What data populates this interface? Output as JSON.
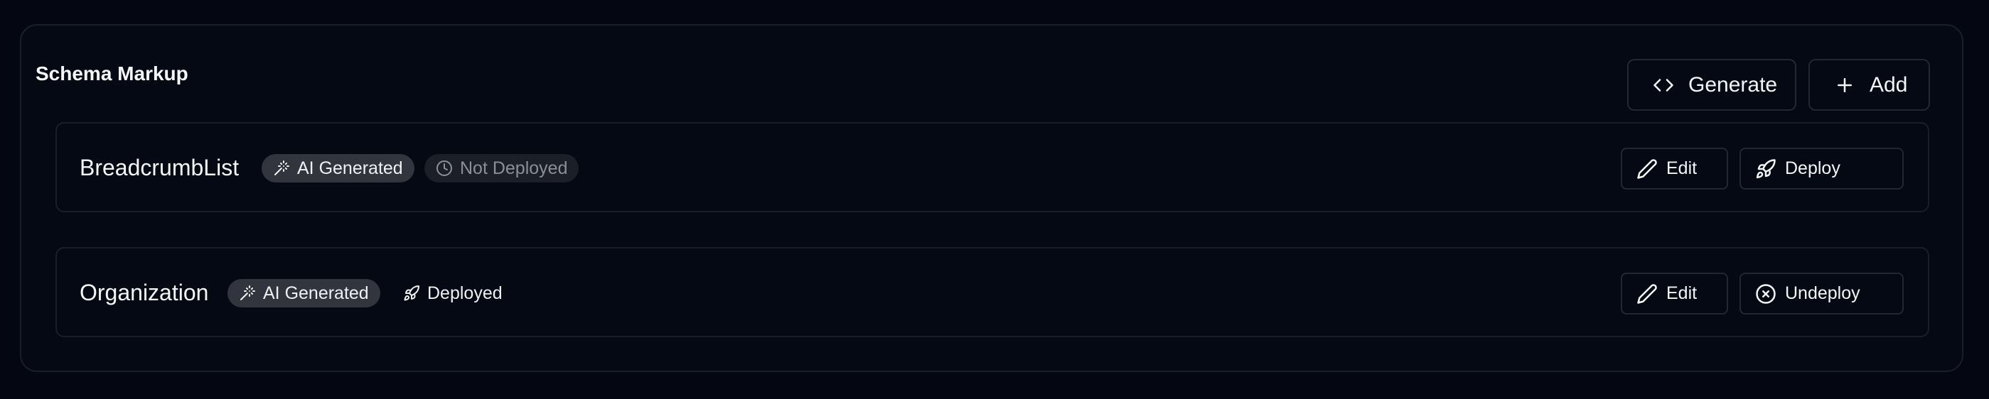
{
  "panel": {
    "title": "Schema Markup",
    "generate_label": "Generate",
    "add_label": "Add"
  },
  "schemas": [
    {
      "name": "BreadcrumbList",
      "ai_badge": "AI Generated",
      "status_label": "Not Deployed",
      "status_icon": "clock-icon",
      "edit_label": "Edit",
      "action_label": "Deploy",
      "action_icon": "rocket-icon"
    },
    {
      "name": "Organization",
      "ai_badge": "AI Generated",
      "status_label": "Deployed",
      "status_icon": "rocket-icon",
      "edit_label": "Edit",
      "action_label": "Undeploy",
      "action_icon": "x-circle-icon"
    }
  ],
  "colors": {
    "background": "#040711",
    "border": "#1a1e28",
    "badge_ai_bg": "#32353e",
    "badge_not_deployed_bg": "#1c1f28",
    "muted_text": "#8a8f9a"
  }
}
